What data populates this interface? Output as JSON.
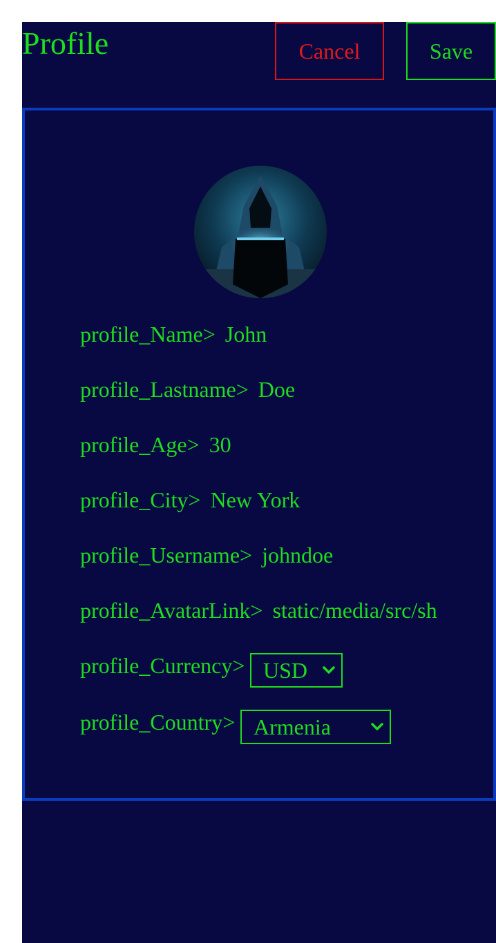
{
  "header": {
    "title": "Profile",
    "cancel_label": "Cancel",
    "save_label": "Save"
  },
  "fields": [
    {
      "label": "profile_Name>",
      "value": "John"
    },
    {
      "label": "profile_Lastname>",
      "value": "Doe"
    },
    {
      "label": "profile_Age>",
      "value": "30"
    },
    {
      "label": "profile_City>",
      "value": "New York"
    },
    {
      "label": "profile_Username>",
      "value": "johndoe"
    },
    {
      "label": "profile_AvatarLink>",
      "value": "static/media/src/sh"
    }
  ],
  "currency": {
    "label": "profile_Currency>",
    "selected": "USD"
  },
  "country": {
    "label": "profile_Country>",
    "selected": "Armenia"
  },
  "colors": {
    "background": "#080843",
    "accent_green": "#1edc1e",
    "cancel_red": "#e01a1a",
    "card_border": "#0b3bbf"
  },
  "icons": {
    "avatar": "hooded-hacker-avatar",
    "dropdown": "chevron-down-icon"
  }
}
